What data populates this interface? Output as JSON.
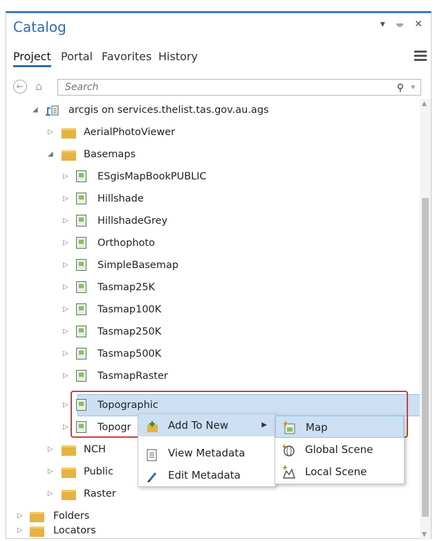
{
  "pane": {
    "title": "Catalog",
    "controls": "▾ ᚚ ✕"
  },
  "tabs": [
    {
      "label": "Project"
    },
    {
      "label": "Portal"
    },
    {
      "label": "Favorites"
    },
    {
      "label": "History"
    }
  ],
  "search": {
    "placeholder": "Search"
  },
  "tree": {
    "server": "arcgis on services.thelist.tas.gov.au.ags",
    "folders_top": [
      "AerialPhotoViewer",
      "Basemaps"
    ],
    "services": [
      "ESgisMapBookPUBLIC",
      "Hillshade",
      "HillshadeGrey",
      "Orthophoto",
      "SimpleBasemap",
      "Tasmap25K",
      "Tasmap100K",
      "Tasmap250K",
      "Tasmap500K",
      "TasmapRaster",
      "Topographic",
      "Topogr"
    ],
    "folders_bottom": [
      "NCH",
      "Public",
      "Raster"
    ],
    "roots": [
      "Folders",
      "Locators"
    ]
  },
  "context_menu": {
    "items": [
      {
        "label": "Add To New"
      },
      {
        "label": "View Metadata"
      },
      {
        "label": "Edit Metadata"
      }
    ]
  },
  "submenu": {
    "items": [
      {
        "label": "Map"
      },
      {
        "label": "Global Scene"
      },
      {
        "label": "Local Scene"
      }
    ]
  },
  "colors": {
    "accent": "#2e6db4",
    "highlight": "#cde0f3",
    "annotation_red": "#d23b3b",
    "folder": "#e6b341"
  }
}
